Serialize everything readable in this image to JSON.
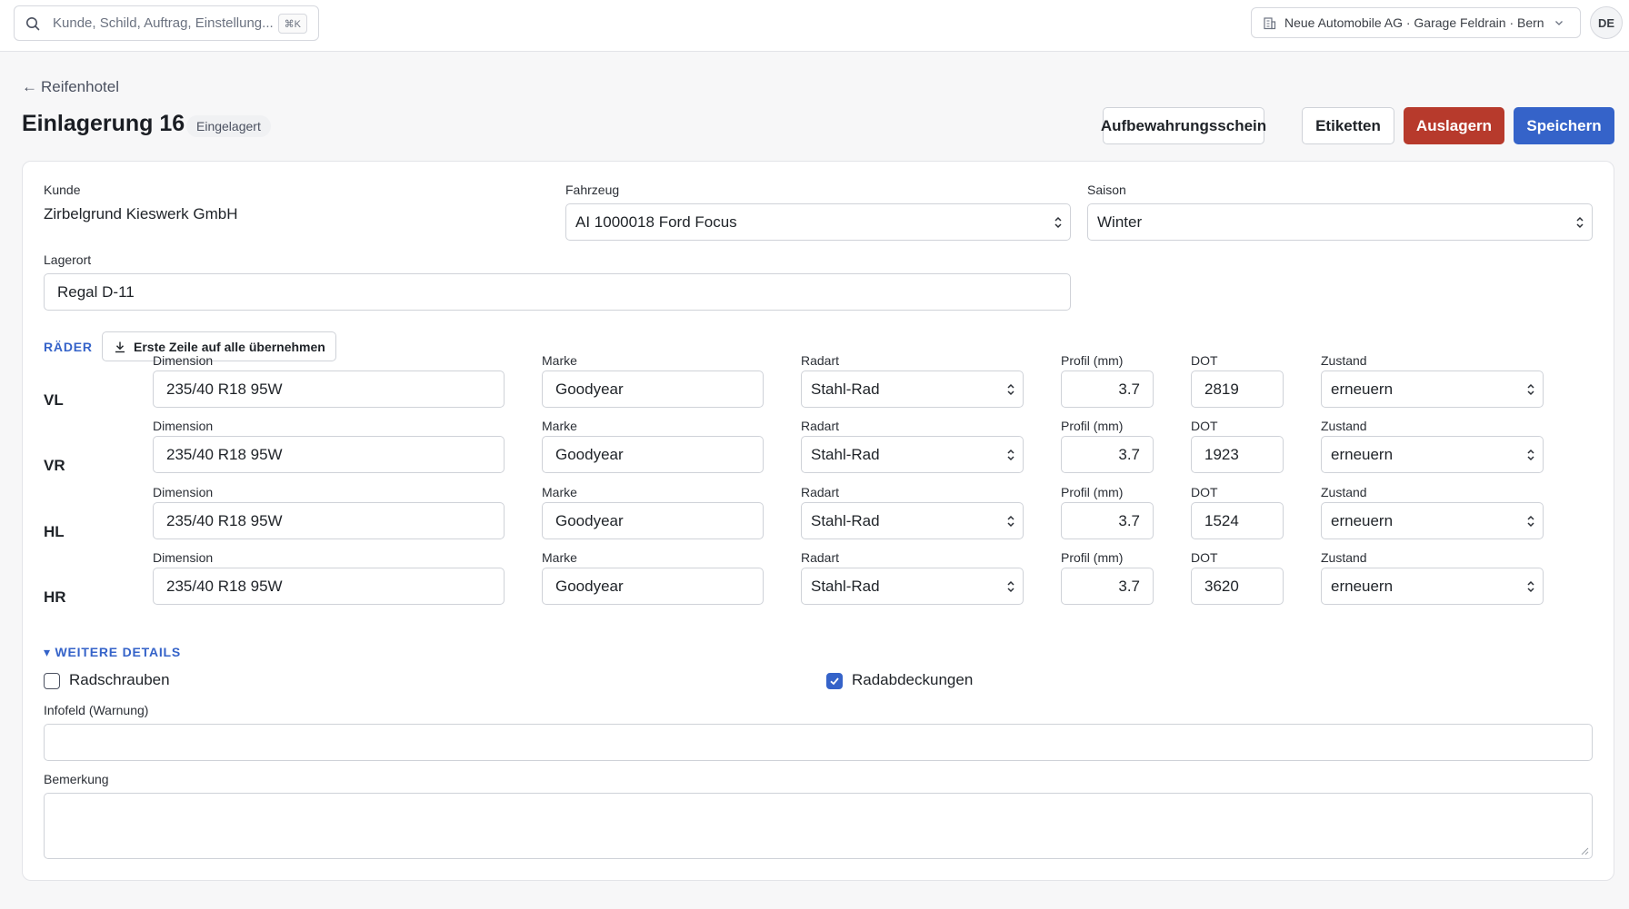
{
  "topbar": {
    "search_placeholder": "Kunde, Schild, Auftrag, Einstellung...",
    "search_shortcut": "⌘K",
    "org_label": "Neue Automobile AG · Garage Feldrain · Bern",
    "lang": "DE"
  },
  "header": {
    "back_label": "Reifenhotel",
    "title": "Einlagerung 16",
    "status": "Eingelagert",
    "buttons": {
      "receipt": "Aufbewahrungsschein",
      "labels": "Etiketten",
      "checkout": "Auslagern",
      "save": "Speichern"
    }
  },
  "form": {
    "customer_label": "Kunde",
    "customer_value": "Zirbelgrund Kieswerk GmbH",
    "vehicle_label": "Fahrzeug",
    "vehicle_value": "AI 1000018 Ford Focus",
    "season_label": "Saison",
    "season_value": "Winter",
    "location_label": "Lagerort",
    "location_value": "Regal D-11"
  },
  "wheels": {
    "section_title": "RÄDER",
    "copy_button": "Erste Zeile auf alle übernehmen",
    "col_labels": {
      "dimension": "Dimension",
      "brand": "Marke",
      "rim": "Radart",
      "profile": "Profil (mm)",
      "dot": "DOT",
      "condition": "Zustand"
    },
    "rows": [
      {
        "pos": "VL",
        "dimension": "235/40 R18 95W",
        "brand": "Goodyear",
        "rim": "Stahl-Rad",
        "profile": "3.7",
        "dot": "2819",
        "condition": "erneuern"
      },
      {
        "pos": "VR",
        "dimension": "235/40 R18 95W",
        "brand": "Goodyear",
        "rim": "Stahl-Rad",
        "profile": "3.7",
        "dot": "1923",
        "condition": "erneuern"
      },
      {
        "pos": "HL",
        "dimension": "235/40 R18 95W",
        "brand": "Goodyear",
        "rim": "Stahl-Rad",
        "profile": "3.7",
        "dot": "1524",
        "condition": "erneuern"
      },
      {
        "pos": "HR",
        "dimension": "235/40 R18 95W",
        "brand": "Goodyear",
        "rim": "Stahl-Rad",
        "profile": "3.7",
        "dot": "3620",
        "condition": "erneuern"
      }
    ]
  },
  "details": {
    "section_title": "▾ WEITERE DETAILS",
    "wheel_bolts_label": "Radschrauben",
    "wheel_bolts_checked": false,
    "hubcaps_label": "Radabdeckungen",
    "hubcaps_checked": true,
    "info_label": "Infofeld (Warnung)",
    "info_value": "",
    "remark_label": "Bemerkung",
    "remark_value": ""
  },
  "colors": {
    "accent": "#3563c9",
    "danger": "#b73a2c"
  }
}
